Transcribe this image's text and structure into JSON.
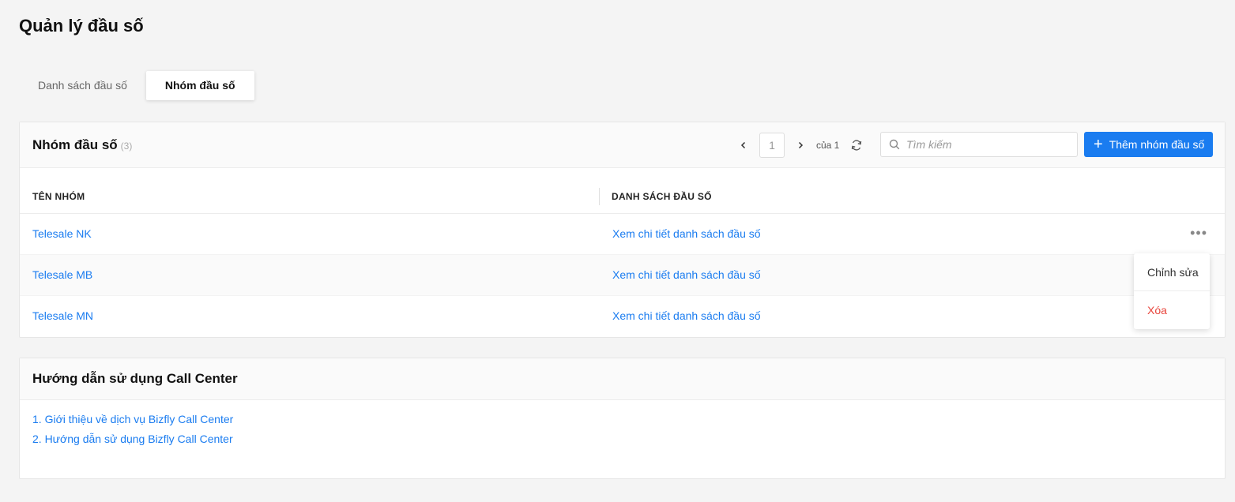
{
  "page": {
    "title": "Quản lý đầu số"
  },
  "tabs": [
    {
      "label": "Danh sách đầu số",
      "active": false
    },
    {
      "label": "Nhóm đầu số",
      "active": true
    }
  ],
  "groups_card": {
    "title": "Nhóm đầu số",
    "count": "(3)",
    "pagination": {
      "current_page": "1",
      "of_label": "của 1"
    },
    "search": {
      "placeholder": "Tìm kiếm"
    },
    "add_button_label": "Thêm nhóm đầu số",
    "columns": [
      "TÊN NHÓM",
      "DANH SÁCH ĐẦU SỐ"
    ],
    "rows": [
      {
        "name": "Telesale NK",
        "link": "Xem chi tiết danh sách đầu số"
      },
      {
        "name": "Telesale MB",
        "link": "Xem chi tiết danh sách đầu số"
      },
      {
        "name": "Telesale MN",
        "link": "Xem chi tiết danh sách đầu số"
      }
    ],
    "row_menu": {
      "edit": "Chỉnh sửa",
      "delete": "Xóa"
    }
  },
  "guide_card": {
    "title": "Hướng dẫn sử dụng Call Center",
    "links": [
      "1. Giới thiệu về dịch vụ Bizfly Call Center",
      "2. Hướng dẫn sử dụng Bizfly Call Center"
    ]
  },
  "colors": {
    "accent": "#1a7cf0",
    "danger": "#e8453c",
    "background": "#f4f4f4"
  },
  "icons": [
    "chevron-left-icon",
    "chevron-right-icon",
    "refresh-icon",
    "search-icon",
    "plus-icon",
    "more-horizontal-icon"
  ]
}
